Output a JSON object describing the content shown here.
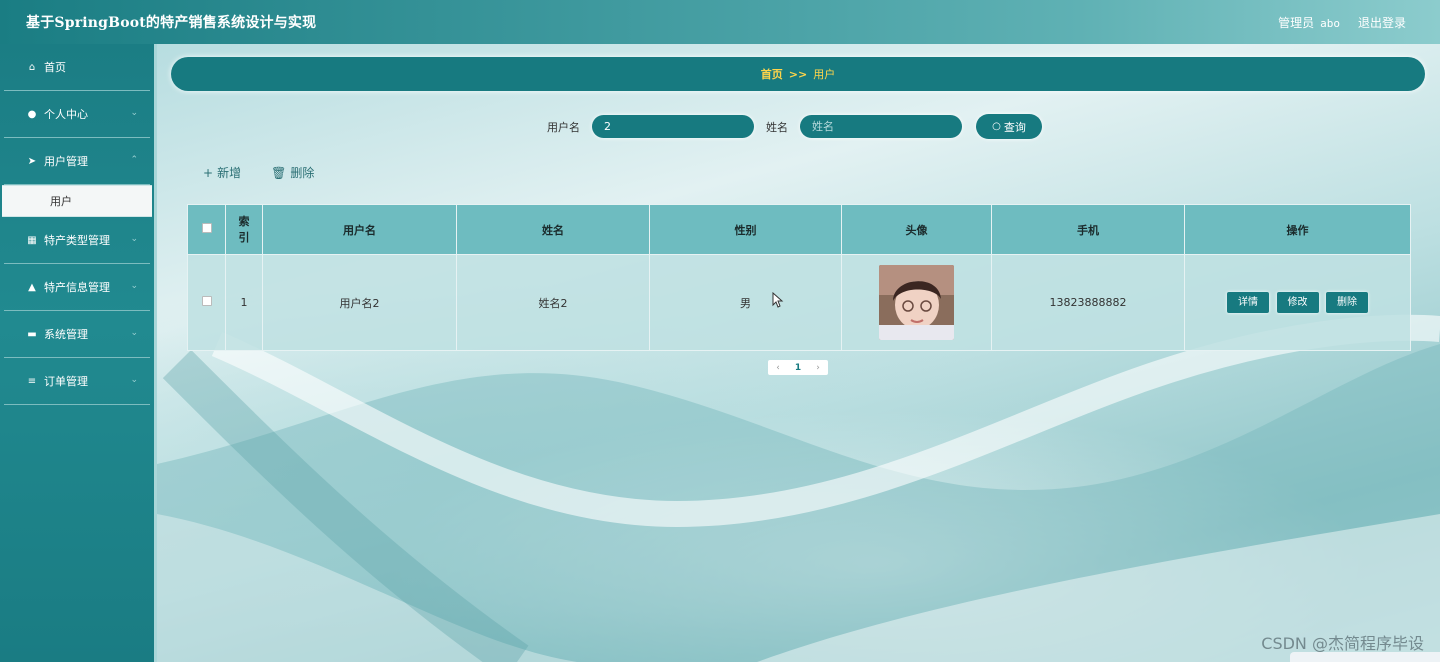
{
  "header": {
    "title": "基于SpringBoot的特产销售系统设计与实现",
    "role": "管理员",
    "username": "abo",
    "logout": "退出登录"
  },
  "sidebar": {
    "items": [
      {
        "label": "首页",
        "icon": "home-icon",
        "has_children": false
      },
      {
        "label": "个人中心",
        "icon": "user-icon",
        "has_children": true
      },
      {
        "label": "用户管理",
        "icon": "send-icon",
        "has_children": true,
        "expanded": true
      },
      {
        "label": "特产类型管理",
        "icon": "grid-icon",
        "has_children": true
      },
      {
        "label": "特产信息管理",
        "icon": "thumb-icon",
        "has_children": true
      },
      {
        "label": "系统管理",
        "icon": "monitor-icon",
        "has_children": true
      },
      {
        "label": "订单管理",
        "icon": "list-icon",
        "has_children": true
      }
    ],
    "active_sub": "用户"
  },
  "breadcrumb": {
    "home": "首页",
    "separator": ">>",
    "current": "用户"
  },
  "search": {
    "username_label": "用户名",
    "username_value": "2",
    "name_label": "姓名",
    "name_placeholder": "姓名",
    "button": "查询"
  },
  "actions": {
    "add": "新增",
    "delete": "删除"
  },
  "table": {
    "headers": {
      "index": "索引",
      "username": "用户名",
      "name": "姓名",
      "gender": "性别",
      "avatar": "头像",
      "phone": "手机",
      "operation": "操作"
    },
    "rows": [
      {
        "index": "1",
        "username": "用户名2",
        "name": "姓名2",
        "gender": "男",
        "phone": "13823888882",
        "ops": {
          "detail": "详情",
          "edit": "修改",
          "delete": "删除"
        }
      }
    ]
  },
  "pager": {
    "prev": "‹",
    "page": "1",
    "next": "›"
  },
  "watermark": "CSDN @杰简程序毕设",
  "colors": {
    "primary": "#177a80",
    "header_start": "#1a7d83",
    "header_end": "#8ccccd",
    "table_header": "#6ebcc0",
    "breadcrumb_text": "#ffd54a"
  }
}
